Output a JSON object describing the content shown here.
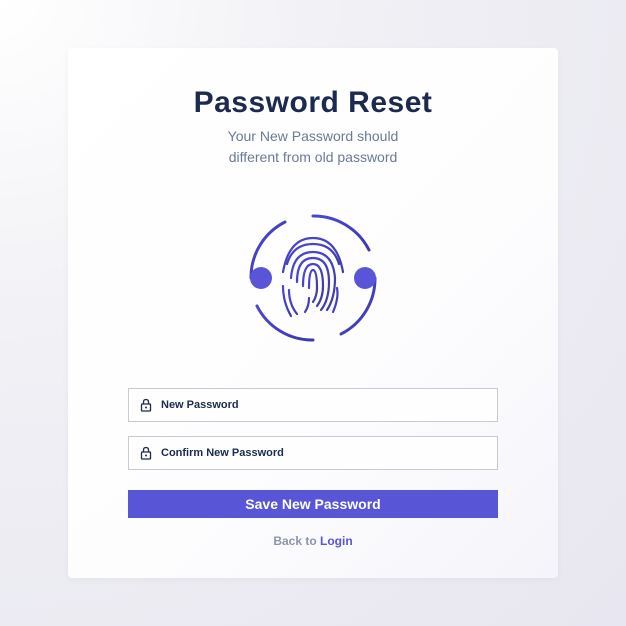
{
  "header": {
    "title": "Password Reset",
    "subtitle_line1": "Your New Password should",
    "subtitle_line2": "different from old password"
  },
  "icons": {
    "fingerprint": "fingerprint-icon",
    "lock": "lock-icon"
  },
  "form": {
    "new_password": {
      "placeholder": "New Password",
      "value": ""
    },
    "confirm_password": {
      "placeholder": "Confirm New Password",
      "value": ""
    },
    "submit_label": "Save New Password"
  },
  "footer": {
    "back_text": "Back to ",
    "login_link": "Login"
  },
  "colors": {
    "primary": "#5856d6",
    "dark_navy": "#1b2a4e",
    "muted": "#6b7a99"
  }
}
